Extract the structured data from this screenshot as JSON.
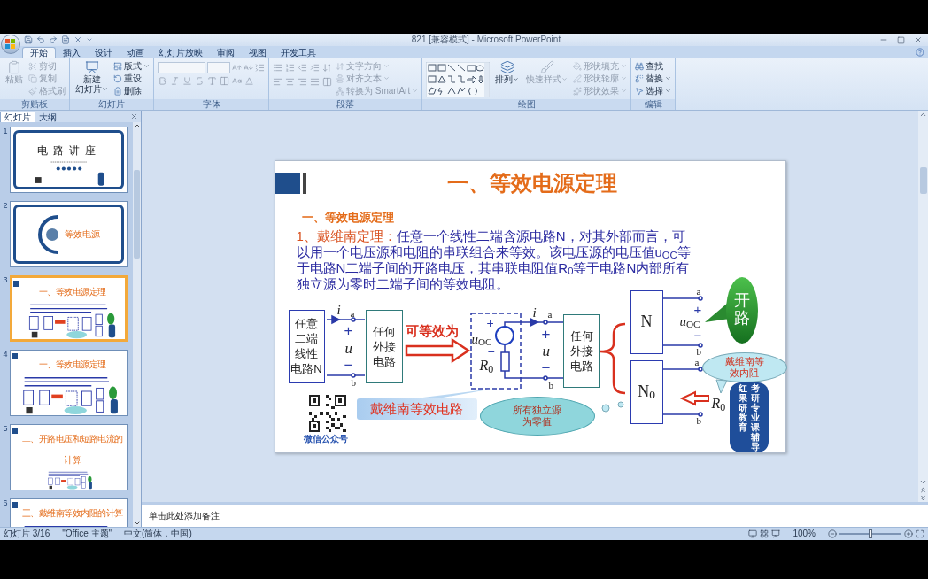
{
  "title_bar": {
    "title": "821 [兼容模式] - Microsoft PowerPoint"
  },
  "ribbon_tabs": [
    {
      "label": "开始",
      "selected": true
    },
    {
      "label": "插入",
      "selected": false
    },
    {
      "label": "设计",
      "selected": false
    },
    {
      "label": "动画",
      "selected": false
    },
    {
      "label": "幻灯片放映",
      "selected": false
    },
    {
      "label": "审阅",
      "selected": false
    },
    {
      "label": "视图",
      "selected": false
    },
    {
      "label": "开发工具",
      "selected": false
    }
  ],
  "ribbon_groups": [
    {
      "kind": "clipboard",
      "label": "剪贴板",
      "items": [
        {
          "kind": "large",
          "label": [
            "粘贴"
          ],
          "disabled": true,
          "dropdown": false
        },
        {
          "kind": "small",
          "label": "剪切",
          "disabled": true,
          "dropdown": false
        },
        {
          "kind": "small",
          "label": "复制",
          "disabled": true,
          "dropdown": false
        },
        {
          "kind": "small",
          "label": "格式刷",
          "disabled": true,
          "dropdown": false
        }
      ]
    },
    {
      "kind": "slides",
      "label": "幻灯片",
      "items": [
        {
          "kind": "large",
          "label": [
            "新建",
            "幻灯片"
          ],
          "disabled": false,
          "dropdown": true
        },
        {
          "kind": "small",
          "label": "版式",
          "disabled": false,
          "dropdown": true
        },
        {
          "kind": "small",
          "label": "重设",
          "disabled": false,
          "dropdown": false
        },
        {
          "kind": "small",
          "label": "删除",
          "disabled": false,
          "dropdown": false
        }
      ]
    },
    {
      "kind": "font",
      "label": "字体"
    },
    {
      "kind": "paragraph",
      "label": "段落",
      "items": [
        {
          "kind": "small",
          "label": "文字方向",
          "disabled": true,
          "dropdown": true
        },
        {
          "kind": "small",
          "label": "对齐文本",
          "disabled": true,
          "dropdown": true
        },
        {
          "kind": "small",
          "label": "转换为 SmartArt",
          "disabled": true,
          "dropdown": true
        }
      ]
    },
    {
      "kind": "drawing",
      "label": "绘图",
      "items": [
        {
          "kind": "large",
          "label": [
            "排列"
          ],
          "disabled": false,
          "dropdown": true
        },
        {
          "kind": "large",
          "label": [
            "快速样式"
          ],
          "disabled": true,
          "dropdown": true
        },
        {
          "kind": "small",
          "label": "形状填充",
          "disabled": true,
          "dropdown": true
        },
        {
          "kind": "small",
          "label": "形状轮廓",
          "disabled": true,
          "dropdown": true
        },
        {
          "kind": "small",
          "label": "形状效果",
          "disabled": true,
          "dropdown": true
        }
      ]
    },
    {
      "kind": "editing",
      "label": "编辑",
      "items": [
        {
          "kind": "small",
          "label": "查找",
          "disabled": false,
          "dropdown": false
        },
        {
          "kind": "small",
          "label": "替换",
          "disabled": false,
          "dropdown": true
        },
        {
          "kind": "small",
          "label": "选择",
          "disabled": false,
          "dropdown": true
        }
      ]
    }
  ],
  "slide_panel": {
    "tabs": [
      {
        "label": "幻灯片",
        "selected": true
      },
      {
        "label": "大纲",
        "selected": false
      }
    ],
    "thumbnails": [
      {
        "number": "1",
        "kind": "cover",
        "title": "电路讲座",
        "selected": false
      },
      {
        "number": "2",
        "kind": "section",
        "title": "等效电源",
        "selected": false
      },
      {
        "number": "3",
        "kind": "content",
        "title": "一、等效电源定理",
        "selected": true
      },
      {
        "number": "4",
        "kind": "content",
        "title": "一、等效电源定理",
        "selected": false
      },
      {
        "number": "5",
        "kind": "content",
        "title": "二、开路电压和短路电流的计算",
        "selected": false
      },
      {
        "number": "6",
        "kind": "content",
        "title": "三、戴维南等效内阻的计算",
        "selected": false
      }
    ]
  },
  "slide": {
    "header": "一、等效电源定理",
    "subtitle": "一、等效电源定理",
    "paragraph": {
      "lead": "1、戴维南定理：",
      "body": "任意一个线性二端含源电路N，对其外部而言，可以用一个电压源和电阻的串联组合来等效。该电压源的电压值u$_{OC}$等于电路N二端子间的开路电压，其串联电阻值R$_{0}$等于电路N内部所有独立源为零时二端子间的等效电阻。"
    },
    "diagram": {
      "original": {
        "network": [
          "任意",
          "二端",
          "线性",
          "电路N"
        ],
        "current": "i",
        "terminal_a": "a",
        "terminal_b": "b",
        "plus": "+",
        "voltage": "u",
        "minus": "−",
        "load": [
          "任何",
          "外接",
          "电路"
        ]
      },
      "equivalence_label": "可等效为",
      "equivalent": {
        "plus": "+",
        "source_voltage": "*u*$_{OC}$",
        "minus": "−",
        "resistance": "*R*$_{0}$",
        "current": "i",
        "terminal_a": "a",
        "terminal_b": "b",
        "port_plus": "+",
        "voltage": "u",
        "port_minus": "−",
        "load": [
          "任何",
          "外接",
          "电路"
        ],
        "callout": "戴维南等效电路"
      },
      "cloud": [
        "所有独立源",
        "为零值"
      ],
      "open_network": {
        "name": "N",
        "terminal_a": "a",
        "terminal_b": "b",
        "plus": "+",
        "voltage": "*u*$_{OC}$",
        "minus": "−",
        "bubble": "开路"
      },
      "dead_network": {
        "name": "N$_{0}$",
        "terminal_a": "a",
        "terminal_b": "b",
        "resistance": "*R*$_{0}$",
        "bubble": [
          "戴维南等",
          "效内阻"
        ]
      },
      "qr_caption": "微信公众号",
      "badge": [
        "红果研教育",
        "考研专业课辅导"
      ]
    }
  },
  "notes": {
    "placeholder": "单击此处添加备注"
  },
  "status_bar": {
    "slide_position": "幻灯片 3/16",
    "theme": "\"Office 主题\"",
    "language": "中文(简体，中国)",
    "zoom": {
      "reading": "100%",
      "level": 0.5
    }
  }
}
